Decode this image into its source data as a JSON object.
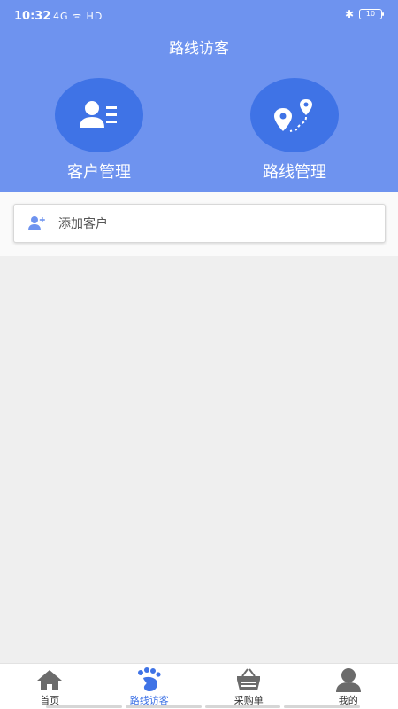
{
  "status": {
    "time": "10:32",
    "signal_text": "4G ᯤ HD",
    "battery": "10"
  },
  "header": {
    "title": "路线访客"
  },
  "quick_actions": [
    {
      "label": "客户管理",
      "icon": "customer-list-icon"
    },
    {
      "label": "路线管理",
      "icon": "route-pin-icon"
    }
  ],
  "add_customer": {
    "label": "添加客户",
    "icon": "add-user-icon"
  },
  "tabs": [
    {
      "label": "首页",
      "icon": "home-icon",
      "active": false
    },
    {
      "label": "路线访客",
      "icon": "footprints-icon",
      "active": true
    },
    {
      "label": "采购单",
      "icon": "basket-icon",
      "active": false
    },
    {
      "label": "我的",
      "icon": "user-icon",
      "active": false
    }
  ],
  "colors": {
    "header": "#6e93ef",
    "accent": "#3f73e6",
    "background": "#efefef"
  }
}
